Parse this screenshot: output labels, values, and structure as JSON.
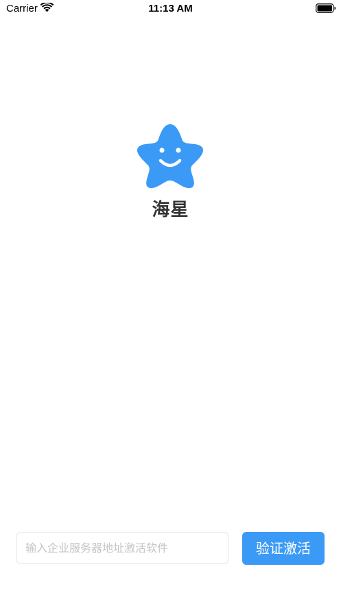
{
  "status_bar": {
    "carrier": "Carrier",
    "time": "11:13 AM",
    "wifi_icon": "wifi-icon",
    "battery_icon": "battery-full-icon"
  },
  "app": {
    "logo_icon": "smiling-star-icon",
    "name": "海星",
    "brand_color": "#3b9af5"
  },
  "activation": {
    "server_address_value": "",
    "server_address_placeholder": "输入企业服务器地址激活软件",
    "activate_label": "验证激活"
  }
}
